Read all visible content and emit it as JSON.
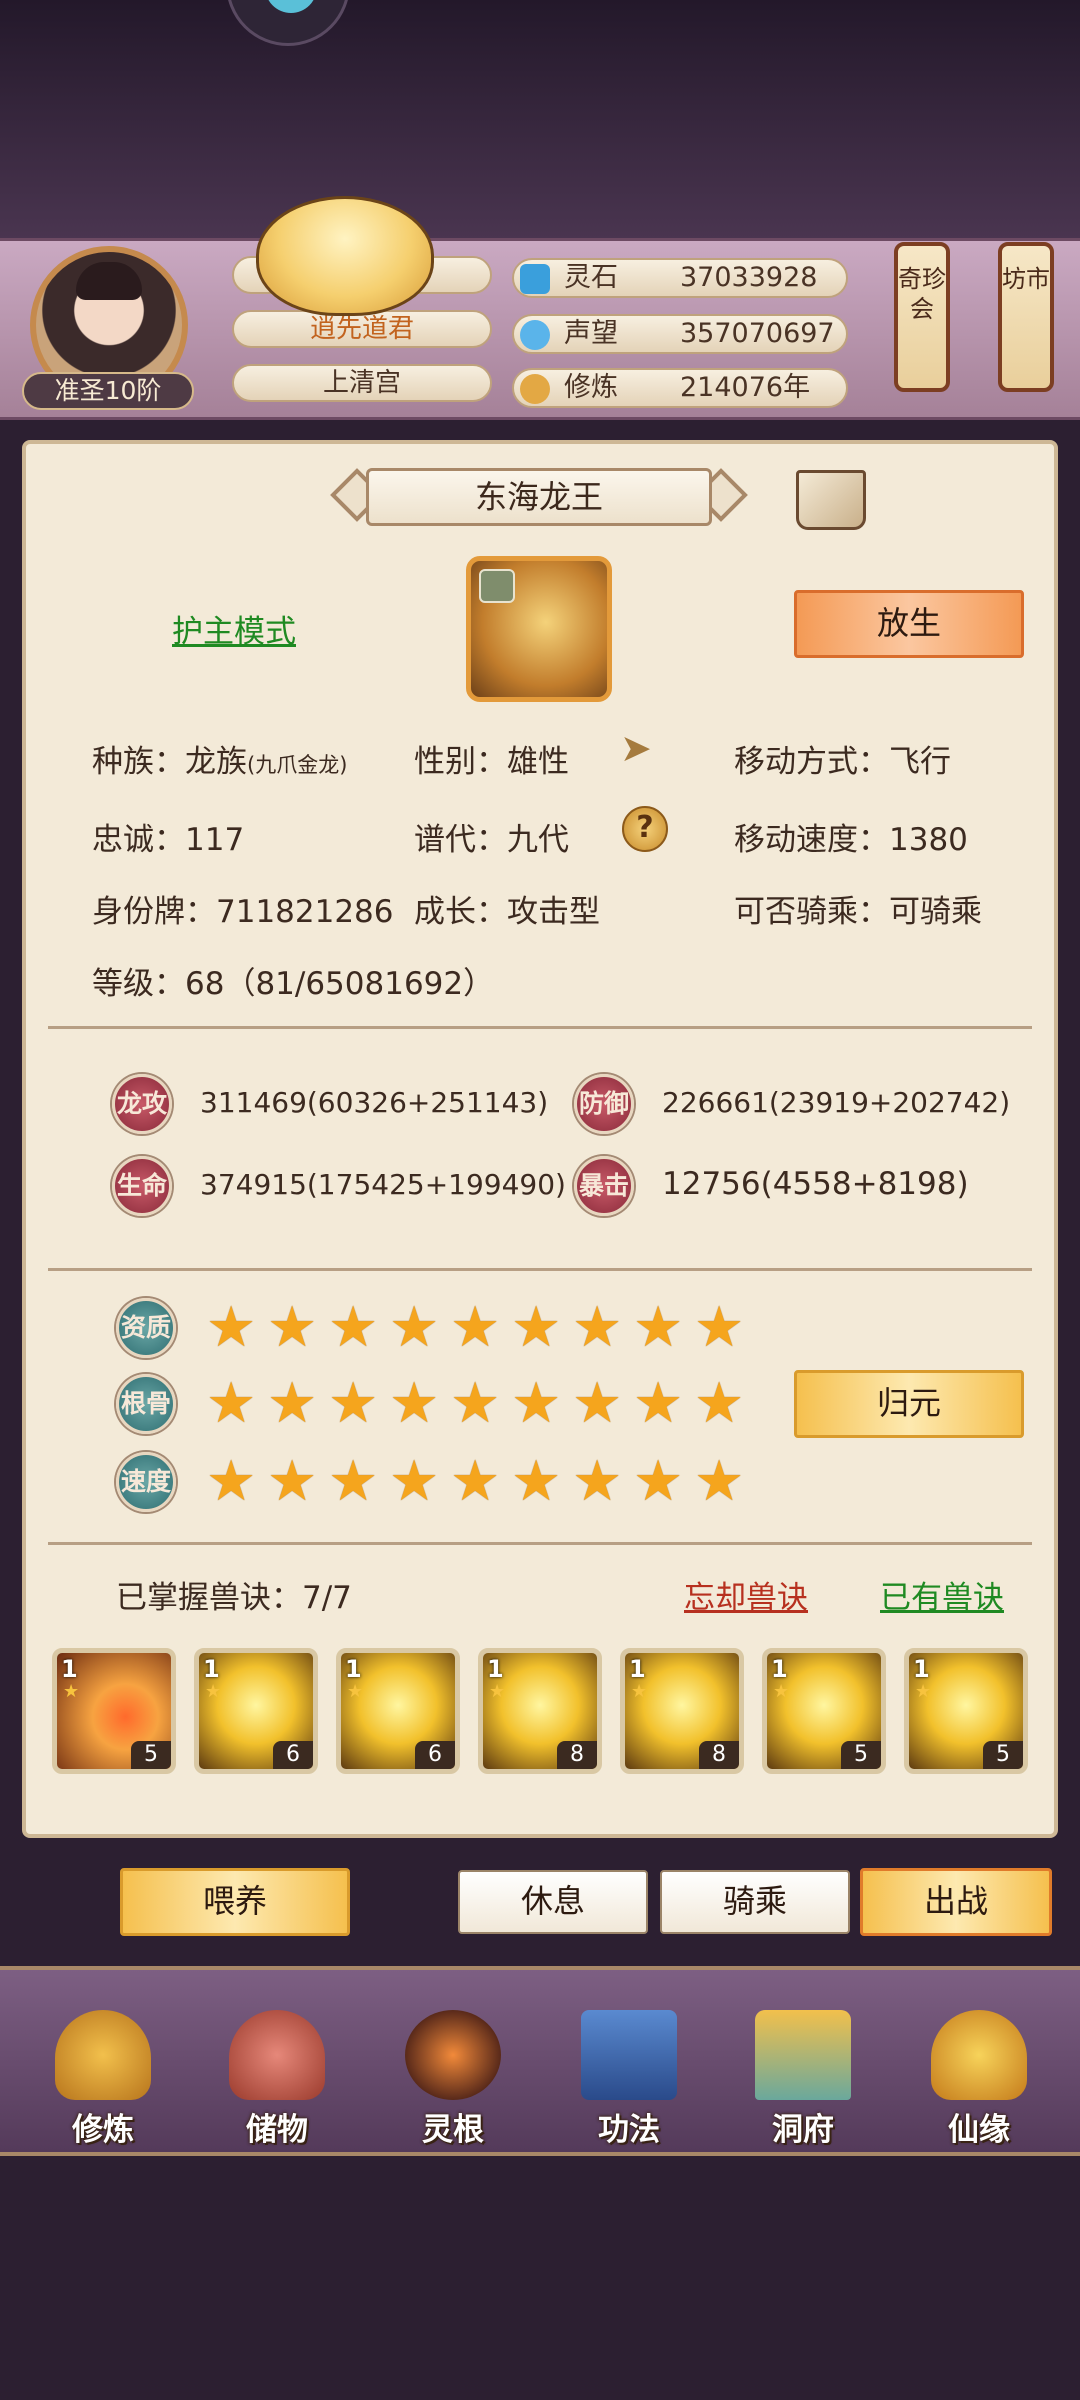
{
  "header": {
    "rank": "准圣10阶",
    "player_title_partial": "逍先道君",
    "sect": "上清宫",
    "resources": [
      {
        "icon": "spirit-stone-icon",
        "label": "灵石",
        "value": "37033928"
      },
      {
        "icon": "prestige-icon",
        "label": "声望",
        "value": "357070697"
      },
      {
        "icon": "cultivation-icon",
        "label": "修炼",
        "value": "214076年"
      }
    ],
    "lanterns": [
      "奇珍会",
      "坊市"
    ]
  },
  "pet": {
    "name": "东海龙王",
    "guard_mode": "护主模式",
    "release_button": "放生",
    "race": "种族：龙族",
    "race_sub": "(九爪金龙)",
    "gender": "性别：雄性",
    "move_type": "移动方式：飞行",
    "loyalty": "忠诚：117",
    "generation": "谱代：九代",
    "move_speed": "移动速度：1380",
    "id_tag": "身份牌：711821286",
    "growth": "成长：攻击型",
    "rideable": "可否骑乘：可骑乘",
    "level": "等级：68（81/65081692）"
  },
  "stats": [
    {
      "label": "龙攻",
      "value": "311469(60326+251143)"
    },
    {
      "label": "防御",
      "value": "226661(23919+202742)"
    },
    {
      "label": "生命",
      "value": "374915(175425+199490)"
    },
    {
      "label": "暴击",
      "value": "12756(4558+8198)"
    }
  ],
  "aptitudes": [
    {
      "label": "资质",
      "stars": 9
    },
    {
      "label": "根骨",
      "stars": 9
    },
    {
      "label": "速度",
      "stars": 9
    }
  ],
  "return_button": "归元",
  "skills": {
    "mastered": "已掌握兽诀：7/7",
    "forget": "忘却兽诀",
    "owned": "已有兽诀",
    "items": [
      {
        "level": "1",
        "count": "5"
      },
      {
        "level": "1",
        "count": "6"
      },
      {
        "level": "1",
        "count": "6"
      },
      {
        "level": "1",
        "count": "8"
      },
      {
        "level": "1",
        "count": "8"
      },
      {
        "level": "1",
        "count": "5"
      },
      {
        "level": "1",
        "count": "5"
      }
    ]
  },
  "actions": {
    "feed": "喂养",
    "rest": "休息",
    "ride": "骑乘",
    "battle": "出战"
  },
  "nav": [
    "修炼",
    "储物",
    "灵根",
    "功法",
    "洞府",
    "仙缘"
  ]
}
